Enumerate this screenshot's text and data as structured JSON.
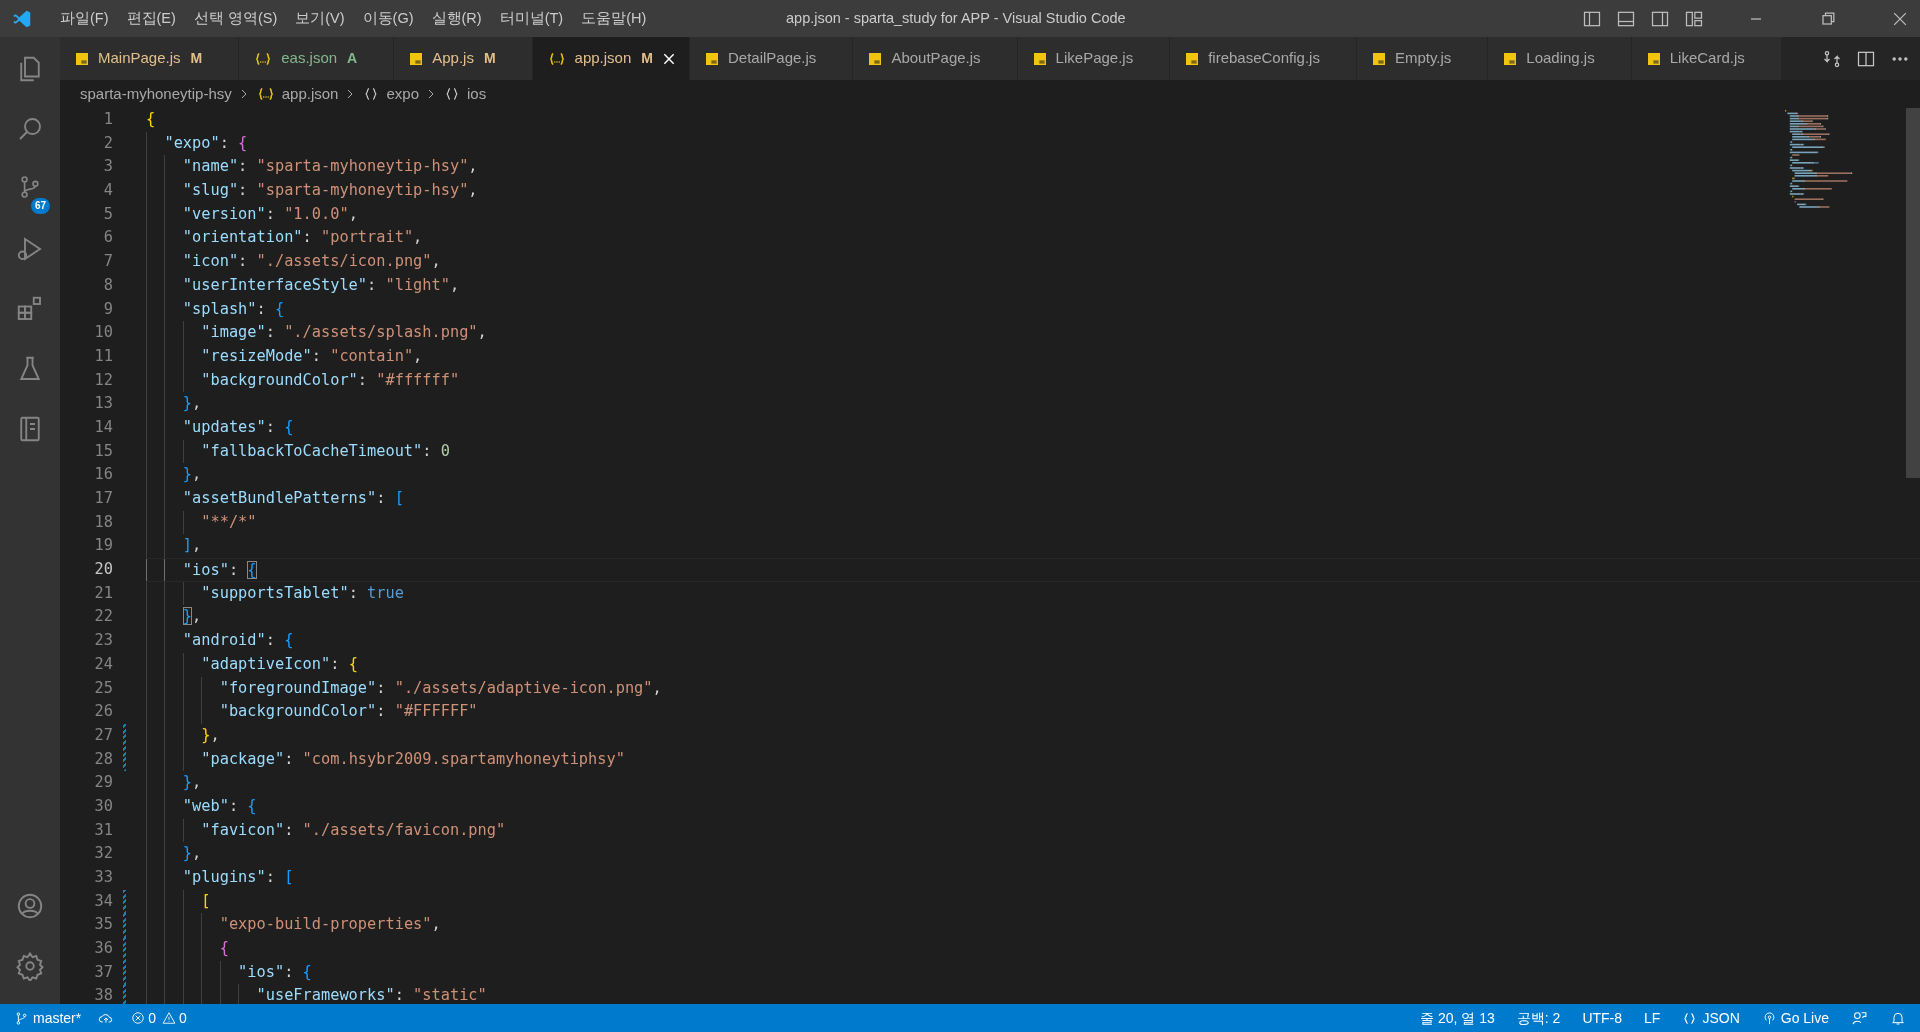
{
  "title_bar": {
    "menus": [
      "파일(F)",
      "편집(E)",
      "선택 영역(S)",
      "보기(V)",
      "이동(G)",
      "실행(R)",
      "터미널(T)",
      "도움말(H)"
    ],
    "title": "app.json - sparta_study for APP - Visual Studio Code"
  },
  "activity_bar": {
    "items": [
      {
        "kind": "explorer"
      },
      {
        "kind": "search"
      },
      {
        "kind": "scm",
        "badge": "67"
      },
      {
        "kind": "debug"
      },
      {
        "kind": "extensions"
      },
      {
        "kind": "testing"
      },
      {
        "kind": "remote"
      }
    ],
    "bottom": [
      {
        "kind": "account"
      },
      {
        "kind": "settings"
      }
    ]
  },
  "tabs": [
    {
      "label": "MainPage.js",
      "kind": "js",
      "badge": "M",
      "color": "#e2c08d",
      "selected": false
    },
    {
      "label": "eas.json",
      "kind": "json",
      "badge": "A",
      "color": "#81b88b",
      "selected": false
    },
    {
      "label": "App.js",
      "kind": "js",
      "badge": "M",
      "color": "#e2c08d",
      "selected": false
    },
    {
      "label": "app.json",
      "kind": "json",
      "badge": "M",
      "color": "#e2c08d",
      "selected": true
    },
    {
      "label": "DetailPage.js",
      "kind": "js",
      "selected": false
    },
    {
      "label": "AboutPage.js",
      "kind": "js",
      "selected": false
    },
    {
      "label": "LikePage.js",
      "kind": "js",
      "selected": false
    },
    {
      "label": "firebaseConfig.js",
      "kind": "js",
      "selected": false
    },
    {
      "label": "Empty.js",
      "kind": "js",
      "selected": false
    },
    {
      "label": "Loading.js",
      "kind": "js",
      "selected": false
    },
    {
      "label": "LikeCard.js",
      "kind": "js",
      "selected": false
    }
  ],
  "breadcrumbs": [
    {
      "kind": "folder",
      "label": "sparta-myhoneytip-hsy"
    },
    {
      "kind": "json",
      "label": "app.json"
    },
    {
      "kind": "object",
      "label": "expo"
    },
    {
      "kind": "object",
      "label": "ios"
    }
  ],
  "editor": {
    "lines": [
      {
        "n": "1",
        "tokens": [
          {
            "kind": "b1",
            "text": "{"
          }
        ]
      },
      {
        "n": "2",
        "tokens": [
          {
            "kind": "key",
            "text": "  \"expo\""
          },
          {
            "kind": "p",
            "text": ": "
          },
          {
            "kind": "b2",
            "text": "{"
          }
        ]
      },
      {
        "n": "3",
        "tokens": [
          {
            "kind": "key",
            "text": "    \"name\""
          },
          {
            "kind": "p",
            "text": ": "
          },
          {
            "kind": "str",
            "text": "\"sparta-myhoneytip-hsy\""
          },
          {
            "kind": "p",
            "text": ","
          }
        ]
      },
      {
        "n": "4",
        "tokens": [
          {
            "kind": "key",
            "text": "    \"slug\""
          },
          {
            "kind": "p",
            "text": ": "
          },
          {
            "kind": "str",
            "text": "\"sparta-myhoneytip-hsy\""
          },
          {
            "kind": "p",
            "text": ","
          }
        ]
      },
      {
        "n": "5",
        "tokens": [
          {
            "kind": "key",
            "text": "    \"version\""
          },
          {
            "kind": "p",
            "text": ": "
          },
          {
            "kind": "str",
            "text": "\"1.0.0\""
          },
          {
            "kind": "p",
            "text": ","
          }
        ]
      },
      {
        "n": "6",
        "tokens": [
          {
            "kind": "key",
            "text": "    \"orientation\""
          },
          {
            "kind": "p",
            "text": ": "
          },
          {
            "kind": "str",
            "text": "\"portrait\""
          },
          {
            "kind": "p",
            "text": ","
          }
        ]
      },
      {
        "n": "7",
        "tokens": [
          {
            "kind": "key",
            "text": "    \"icon\""
          },
          {
            "kind": "p",
            "text": ": "
          },
          {
            "kind": "str",
            "text": "\"./assets/icon.png\""
          },
          {
            "kind": "p",
            "text": ","
          }
        ]
      },
      {
        "n": "8",
        "tokens": [
          {
            "kind": "key",
            "text": "    \"userInterfaceStyle\""
          },
          {
            "kind": "p",
            "text": ": "
          },
          {
            "kind": "str",
            "text": "\"light\""
          },
          {
            "kind": "p",
            "text": ","
          }
        ]
      },
      {
        "n": "9",
        "tokens": [
          {
            "kind": "key",
            "text": "    \"splash\""
          },
          {
            "kind": "p",
            "text": ": "
          },
          {
            "kind": "b3",
            "text": "{"
          }
        ]
      },
      {
        "n": "10",
        "tokens": [
          {
            "kind": "key",
            "text": "      \"image\""
          },
          {
            "kind": "p",
            "text": ": "
          },
          {
            "kind": "str",
            "text": "\"./assets/splash.png\""
          },
          {
            "kind": "p",
            "text": ","
          }
        ]
      },
      {
        "n": "11",
        "tokens": [
          {
            "kind": "key",
            "text": "      \"resizeMode\""
          },
          {
            "kind": "p",
            "text": ": "
          },
          {
            "kind": "str",
            "text": "\"contain\""
          },
          {
            "kind": "p",
            "text": ","
          }
        ]
      },
      {
        "n": "12",
        "tokens": [
          {
            "kind": "key",
            "text": "      \"backgroundColor\""
          },
          {
            "kind": "p",
            "text": ": "
          },
          {
            "kind": "str",
            "text": "\"#ffffff\""
          }
        ]
      },
      {
        "n": "13",
        "tokens": [
          {
            "kind": "b3",
            "text": "    }"
          },
          {
            "kind": "p",
            "text": ","
          }
        ]
      },
      {
        "n": "14",
        "tokens": [
          {
            "kind": "key",
            "text": "    \"updates\""
          },
          {
            "kind": "p",
            "text": ": "
          },
          {
            "kind": "b3",
            "text": "{"
          }
        ]
      },
      {
        "n": "15",
        "tokens": [
          {
            "kind": "key",
            "text": "      \"fallbackToCacheTimeout\""
          },
          {
            "kind": "p",
            "text": ": "
          },
          {
            "kind": "num",
            "text": "0"
          }
        ]
      },
      {
        "n": "16",
        "tokens": [
          {
            "kind": "b3",
            "text": "    }"
          },
          {
            "kind": "p",
            "text": ","
          }
        ]
      },
      {
        "n": "17",
        "tokens": [
          {
            "kind": "key",
            "text": "    \"assetBundlePatterns\""
          },
          {
            "kind": "p",
            "text": ": "
          },
          {
            "kind": "b3",
            "text": "["
          }
        ]
      },
      {
        "n": "18",
        "tokens": [
          {
            "kind": "str",
            "text": "      \"**/*\""
          }
        ]
      },
      {
        "n": "19",
        "tokens": [
          {
            "kind": "b3",
            "text": "    ]"
          },
          {
            "kind": "p",
            "text": ","
          }
        ]
      },
      {
        "n": "20",
        "current": true,
        "tokens": [
          {
            "kind": "key",
            "text": "    \"ios\""
          },
          {
            "kind": "p",
            "text": ": "
          },
          {
            "kind": "b3",
            "text": "{",
            "matched": true
          }
        ]
      },
      {
        "n": "21",
        "tokens": [
          {
            "kind": "key",
            "text": "      \"supportsTablet\""
          },
          {
            "kind": "p",
            "text": ": "
          },
          {
            "kind": "bool",
            "text": "true"
          }
        ]
      },
      {
        "n": "22",
        "tokens": [
          {
            "kind": "b3",
            "text": "    }",
            "matched": true
          },
          {
            "kind": "p",
            "text": ","
          }
        ]
      },
      {
        "n": "23",
        "tokens": [
          {
            "kind": "key",
            "text": "    \"android\""
          },
          {
            "kind": "p",
            "text": ": "
          },
          {
            "kind": "b3",
            "text": "{"
          }
        ]
      },
      {
        "n": "24",
        "tokens": [
          {
            "kind": "key",
            "text": "      \"adaptiveIcon\""
          },
          {
            "kind": "p",
            "text": ": "
          },
          {
            "kind": "b1",
            "text": "{"
          }
        ]
      },
      {
        "n": "25",
        "tokens": [
          {
            "kind": "key",
            "text": "        \"foregroundImage\""
          },
          {
            "kind": "p",
            "text": ": "
          },
          {
            "kind": "str",
            "text": "\"./assets/adaptive-icon.png\""
          },
          {
            "kind": "p",
            "text": ","
          }
        ]
      },
      {
        "n": "26",
        "tokens": [
          {
            "kind": "key",
            "text": "        \"backgroundColor\""
          },
          {
            "kind": "p",
            "text": ": "
          },
          {
            "kind": "str",
            "text": "\"#FFFFFF\""
          }
        ]
      },
      {
        "n": "27",
        "changed": true,
        "tokens": [
          {
            "kind": "b1",
            "text": "      }"
          },
          {
            "kind": "p",
            "text": ","
          }
        ]
      },
      {
        "n": "28",
        "changed": true,
        "tokens": [
          {
            "kind": "key",
            "text": "      \"package\""
          },
          {
            "kind": "p",
            "text": ": "
          },
          {
            "kind": "str",
            "text": "\"com.hsybr2009.spartamyhoneytiphsy\""
          }
        ]
      },
      {
        "n": "29",
        "tokens": [
          {
            "kind": "b3",
            "text": "    }"
          },
          {
            "kind": "p",
            "text": ","
          }
        ]
      },
      {
        "n": "30",
        "tokens": [
          {
            "kind": "key",
            "text": "    \"web\""
          },
          {
            "kind": "p",
            "text": ": "
          },
          {
            "kind": "b3",
            "text": "{"
          }
        ]
      },
      {
        "n": "31",
        "tokens": [
          {
            "kind": "key",
            "text": "      \"favicon\""
          },
          {
            "kind": "p",
            "text": ": "
          },
          {
            "kind": "str",
            "text": "\"./assets/favicon.png\""
          }
        ]
      },
      {
        "n": "32",
        "tokens": [
          {
            "kind": "b3",
            "text": "    }"
          },
          {
            "kind": "p",
            "text": ","
          }
        ]
      },
      {
        "n": "33",
        "tokens": [
          {
            "kind": "key",
            "text": "    \"plugins\""
          },
          {
            "kind": "p",
            "text": ": "
          },
          {
            "kind": "b3",
            "text": "["
          }
        ]
      },
      {
        "n": "34",
        "changed": true,
        "tokens": [
          {
            "kind": "b1",
            "text": "      ["
          }
        ]
      },
      {
        "n": "35",
        "changed": true,
        "tokens": [
          {
            "kind": "str",
            "text": "        \"expo-build-properties\""
          },
          {
            "kind": "p",
            "text": ","
          }
        ]
      },
      {
        "n": "36",
        "changed": true,
        "tokens": [
          {
            "kind": "b2",
            "text": "        {"
          }
        ]
      },
      {
        "n": "37",
        "changed": true,
        "tokens": [
          {
            "kind": "key",
            "text": "          \"ios\""
          },
          {
            "kind": "p",
            "text": ": "
          },
          {
            "kind": "b3",
            "text": "{"
          }
        ]
      },
      {
        "n": "38",
        "changed": true,
        "tokens": [
          {
            "kind": "key",
            "text": "            \"useFrameworks\""
          },
          {
            "kind": "p",
            "text": ": "
          },
          {
            "kind": "str",
            "text": "\"static\""
          }
        ]
      }
    ]
  },
  "status_bar": {
    "left": [
      {
        "kind": "branch",
        "label": "master*"
      },
      {
        "kind": "sync"
      },
      {
        "kind": "problems",
        "errors": "0",
        "warnings": "0"
      }
    ],
    "right": [
      {
        "kind": "text",
        "label": "줄 20, 열 13"
      },
      {
        "kind": "text",
        "label": "공백: 2"
      },
      {
        "kind": "text",
        "label": "UTF-8"
      },
      {
        "kind": "text",
        "label": "LF"
      },
      {
        "kind": "language",
        "label": "JSON"
      },
      {
        "kind": "golive",
        "label": "Go Live"
      },
      {
        "kind": "feedback"
      },
      {
        "kind": "bell"
      }
    ]
  }
}
